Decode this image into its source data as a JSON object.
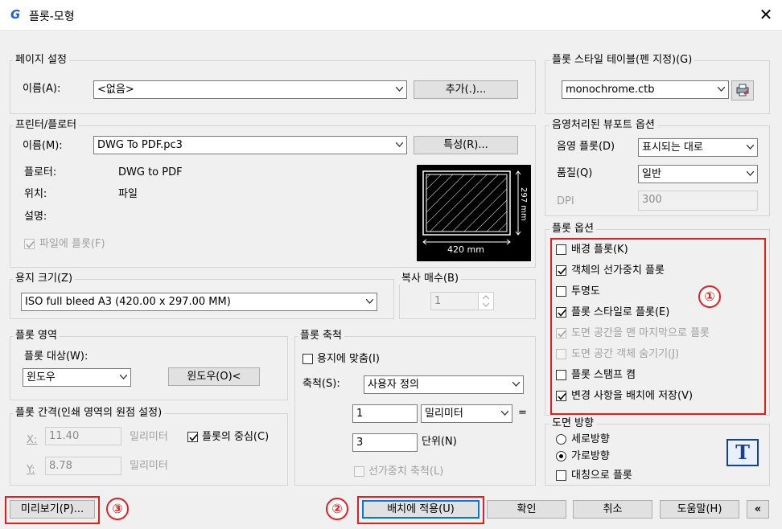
{
  "window": {
    "title": "플롯-모형",
    "close_label": "✕"
  },
  "page_setup": {
    "legend": "페이지 설정",
    "name_label": "이름(A):",
    "name_value": "<없음>",
    "add_button": "추가(.)..."
  },
  "printer": {
    "legend": "프린터/플로터",
    "name_label": "이름(M):",
    "name_value": "DWG To PDF.pc3",
    "properties_button": "특성(R)...",
    "plotter_label": "플로터:",
    "plotter_value": "DWG to PDF",
    "location_label": "위치:",
    "location_value": "파일",
    "description_label": "설명:",
    "plot_to_file_label": "파일에 플롯(F)",
    "plot_to_file_checked": true,
    "preview_width_text": "420 mm",
    "preview_height_text": "297 mm"
  },
  "paper_size": {
    "legend": "용지 크기(Z)",
    "value": "ISO full bleed A3 (420.00 x 297.00 MM)"
  },
  "copies": {
    "legend": "복사 매수(B)",
    "value": "1"
  },
  "plot_area": {
    "legend": "플롯 영역",
    "what_label": "플롯 대상(W):",
    "what_value": "윈도우",
    "window_button": "윈도우(O)<"
  },
  "plot_offset": {
    "legend": "플롯 간격(인쇄 영역의 원점 설정)",
    "x_label": "X:",
    "x_value": "11.40",
    "x_unit": "밀리미터",
    "y_label": "Y:",
    "y_value": "8.78",
    "y_unit": "밀리미터",
    "center_label": "플롯의 중심(C)",
    "center_checked": true
  },
  "plot_scale": {
    "legend": "플롯 축척",
    "fit_label": "용지에 맞춤(I)",
    "fit_checked": false,
    "scale_label": "축척(S):",
    "scale_value": "사용자 정의",
    "value1": "1",
    "unit1": "밀리미터",
    "equals": "=",
    "value2": "3",
    "unit2": "단위(N)",
    "lineweights_label": "선가중치 축척(L)",
    "lineweights_checked": false
  },
  "style_table": {
    "legend": "플롯 스타일 테이블(펜 지정)(G)",
    "value": "monochrome.ctb",
    "edit_icon": "printer-edit-icon"
  },
  "shaded_viewport": {
    "legend": "음영처리된 뷰포트 옵션",
    "shade_label": "음영 플롯(D)",
    "shade_value": "표시되는 대로",
    "quality_label": "품질(Q)",
    "quality_value": "일반",
    "dpi_label": "DPI",
    "dpi_value": "300"
  },
  "plot_options": {
    "legend": "플롯 옵션",
    "items": [
      {
        "label": "배경 플롯(K)",
        "checked": false,
        "disabled": false
      },
      {
        "label": "객체의 선가중치 플롯",
        "checked": true,
        "disabled": false
      },
      {
        "label": "투명도",
        "checked": false,
        "disabled": false
      },
      {
        "label": "플롯 스타일로 플롯(E)",
        "checked": true,
        "disabled": false
      },
      {
        "label": "도면 공간을 맨 마지막으로 플롯",
        "checked": true,
        "disabled": true
      },
      {
        "label": "도면 공간 객체 숨기기(J)",
        "checked": false,
        "disabled": true
      },
      {
        "label": "플롯 스탬프 켬",
        "checked": false,
        "disabled": false
      },
      {
        "label": "변경 사항을 배치에 저장(V)",
        "checked": true,
        "disabled": false
      }
    ]
  },
  "orientation": {
    "legend": "도면 방향",
    "portrait_label": "세로방향",
    "landscape_label": "가로방향",
    "selected": "landscape",
    "upside_down_label": "대칭으로 플롯",
    "upside_down_checked": false,
    "icon_letter": "T"
  },
  "footer": {
    "preview_button": "미리보기(P)...",
    "apply_button": "배치에 적용(U)",
    "ok_button": "확인",
    "cancel_button": "취소",
    "help_button": "도움말(H)",
    "collapse_button": "«"
  },
  "annotations": {
    "mark1": "①",
    "mark2": "②",
    "mark3": "③"
  },
  "colors": {
    "highlight": "#e02020",
    "focus": "#0078d7",
    "app_icon": "#1e5fd6"
  }
}
